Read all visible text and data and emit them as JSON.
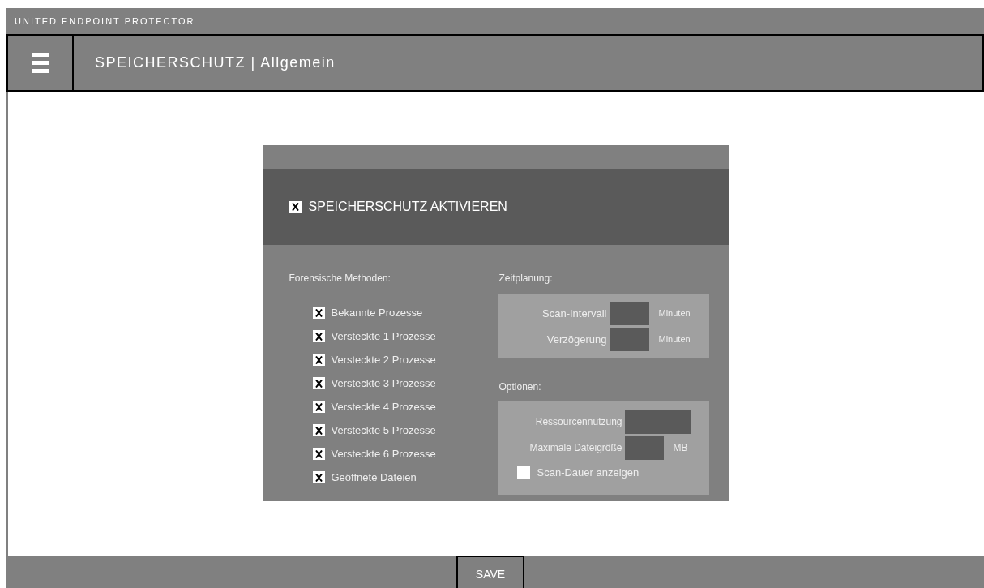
{
  "app_title": "UNITED ENDPOINT PROTECTOR",
  "header": {
    "title": "SPEICHERSCHUTZ | Allgemein"
  },
  "master_toggle": {
    "label": "SPEICHERSCHUTZ AKTIVIEREN",
    "checked": true
  },
  "forensic_methods": {
    "heading": "Forensische Methoden:",
    "items": [
      {
        "label": "Bekannte Prozesse",
        "checked": true
      },
      {
        "label": "Versteckte 1 Prozesse",
        "checked": true
      },
      {
        "label": "Versteckte 2 Prozesse",
        "checked": true
      },
      {
        "label": "Versteckte 3 Prozesse",
        "checked": true
      },
      {
        "label": "Versteckte 4 Prozesse",
        "checked": true
      },
      {
        "label": "Versteckte 5 Prozesse",
        "checked": true
      },
      {
        "label": "Versteckte 6 Prozesse",
        "checked": true
      },
      {
        "label": "Geöffnete Dateien",
        "checked": true
      }
    ]
  },
  "scheduling": {
    "heading": "Zeitplanung:",
    "fields": [
      {
        "label": "Scan-Intervall",
        "unit": "Minuten"
      },
      {
        "label": "Verzögerung",
        "unit": "Minuten"
      }
    ]
  },
  "options": {
    "heading": "Optionen:",
    "fields": [
      {
        "label": "Ressourcennutzung",
        "kind": "wide"
      },
      {
        "label": "Maximale Dateigröße",
        "kind": "unit",
        "unit": "MB"
      }
    ],
    "checkbox": {
      "label": "Scan-Dauer anzeigen",
      "checked": false
    }
  },
  "footer": {
    "button": "SAVE"
  }
}
